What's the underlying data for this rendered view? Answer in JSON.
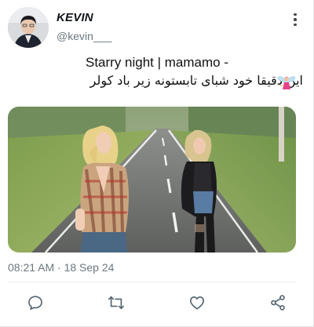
{
  "tweet": {
    "author_name": "KEVIN",
    "author_handle": "@kevin___",
    "line1": "Starry night | mamamo -",
    "line2": "این دقیقا خود شبای تابستونه زیر باد کولر",
    "emoji": "fairy-emoji",
    "timestamp": "08:21 AM · 18 Sep 24"
  },
  "icons": {
    "more": "more-vertical-icon",
    "reply": "comment-bubble-icon",
    "retweet": "retweet-icon",
    "like": "heart-icon",
    "share": "share-nodes-icon"
  },
  "colors": {
    "text": "#0f1419",
    "secondary": "#6b7781",
    "icon": "#536471"
  }
}
